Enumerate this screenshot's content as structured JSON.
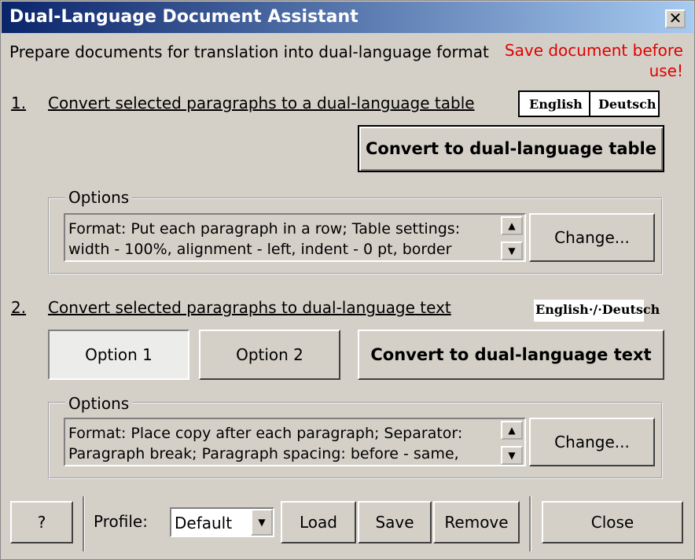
{
  "window": {
    "title": "Dual-Language Document Assistant",
    "close_glyph": "✕"
  },
  "intro": "Prepare documents for translation into dual-language format",
  "warning": {
    "line1": "Save document before",
    "line2": "use!"
  },
  "section1": {
    "number": "1.",
    "heading": "Convert selected paragraphs to a dual-language table",
    "preview_left": "English",
    "preview_right": "Deutsch",
    "convert_label": "Convert to dual-language table",
    "options_label": "Options",
    "options_line1": "Format: Put each paragraph in a row; Table settings:",
    "options_line2": "width - 100%, alignment - left, indent - 0 pt, border",
    "change_label": "Change..."
  },
  "section2": {
    "number": "2.",
    "heading": "Convert selected paragraphs to dual-language text",
    "preview": "English·/·Deutsch",
    "option1_label": "Option 1",
    "option2_label": "Option 2",
    "convert_label": "Convert to dual-language text",
    "options_label": "Options",
    "options_line1": "Format: Place copy after each paragraph; Separator:",
    "options_line2": "Paragraph break; Paragraph spacing: before - same,",
    "change_label": "Change..."
  },
  "footer": {
    "help_label": "?",
    "profile_label": "Profile:",
    "profile_value": "Default",
    "load_label": "Load",
    "save_label": "Save",
    "remove_label": "Remove",
    "close_label": "Close"
  },
  "icons": {
    "scroll_up": "▲",
    "scroll_down": "▼",
    "dropdown": "▼"
  },
  "colors": {
    "warning": "#e00000",
    "title_bar": "#0a246a"
  }
}
